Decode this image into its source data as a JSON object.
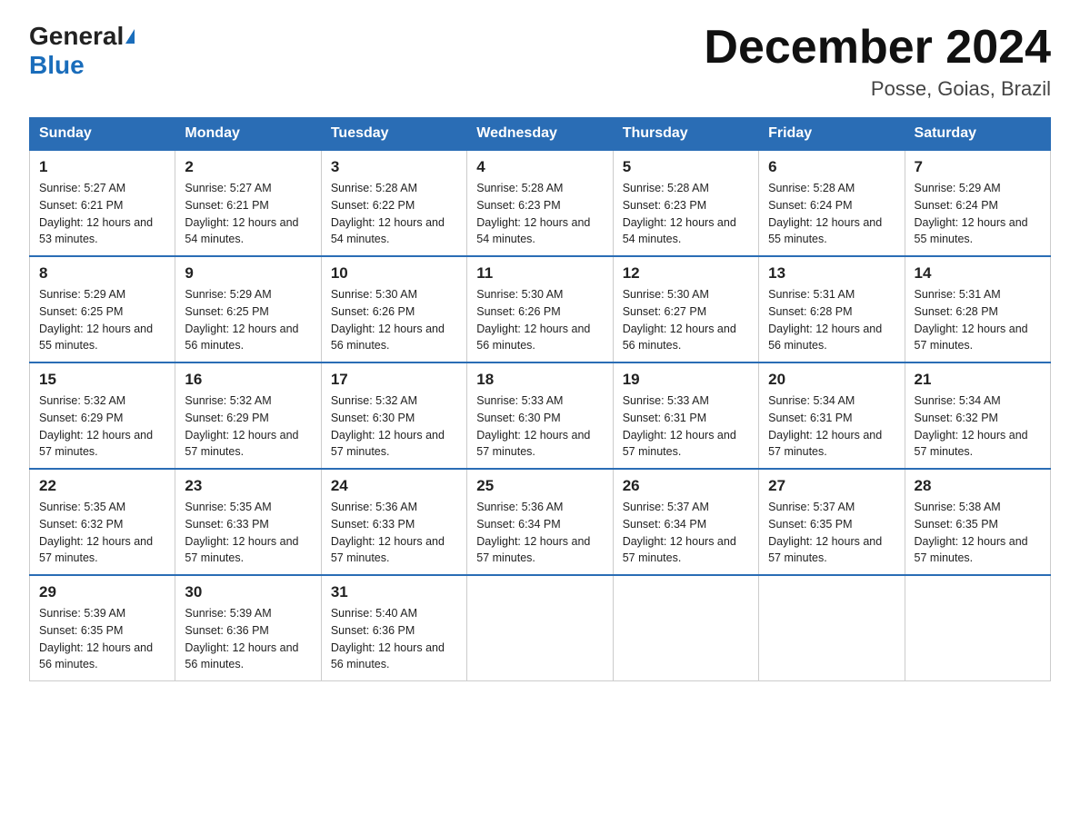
{
  "header": {
    "logo_general": "General",
    "logo_blue": "Blue",
    "month_title": "December 2024",
    "location": "Posse, Goias, Brazil"
  },
  "days_of_week": [
    "Sunday",
    "Monday",
    "Tuesday",
    "Wednesday",
    "Thursday",
    "Friday",
    "Saturday"
  ],
  "weeks": [
    [
      {
        "day": "1",
        "sunrise": "5:27 AM",
        "sunset": "6:21 PM",
        "daylight": "12 hours and 53 minutes."
      },
      {
        "day": "2",
        "sunrise": "5:27 AM",
        "sunset": "6:21 PM",
        "daylight": "12 hours and 54 minutes."
      },
      {
        "day": "3",
        "sunrise": "5:28 AM",
        "sunset": "6:22 PM",
        "daylight": "12 hours and 54 minutes."
      },
      {
        "day": "4",
        "sunrise": "5:28 AM",
        "sunset": "6:23 PM",
        "daylight": "12 hours and 54 minutes."
      },
      {
        "day": "5",
        "sunrise": "5:28 AM",
        "sunset": "6:23 PM",
        "daylight": "12 hours and 54 minutes."
      },
      {
        "day": "6",
        "sunrise": "5:28 AM",
        "sunset": "6:24 PM",
        "daylight": "12 hours and 55 minutes."
      },
      {
        "day": "7",
        "sunrise": "5:29 AM",
        "sunset": "6:24 PM",
        "daylight": "12 hours and 55 minutes."
      }
    ],
    [
      {
        "day": "8",
        "sunrise": "5:29 AM",
        "sunset": "6:25 PM",
        "daylight": "12 hours and 55 minutes."
      },
      {
        "day": "9",
        "sunrise": "5:29 AM",
        "sunset": "6:25 PM",
        "daylight": "12 hours and 56 minutes."
      },
      {
        "day": "10",
        "sunrise": "5:30 AM",
        "sunset": "6:26 PM",
        "daylight": "12 hours and 56 minutes."
      },
      {
        "day": "11",
        "sunrise": "5:30 AM",
        "sunset": "6:26 PM",
        "daylight": "12 hours and 56 minutes."
      },
      {
        "day": "12",
        "sunrise": "5:30 AM",
        "sunset": "6:27 PM",
        "daylight": "12 hours and 56 minutes."
      },
      {
        "day": "13",
        "sunrise": "5:31 AM",
        "sunset": "6:28 PM",
        "daylight": "12 hours and 56 minutes."
      },
      {
        "day": "14",
        "sunrise": "5:31 AM",
        "sunset": "6:28 PM",
        "daylight": "12 hours and 57 minutes."
      }
    ],
    [
      {
        "day": "15",
        "sunrise": "5:32 AM",
        "sunset": "6:29 PM",
        "daylight": "12 hours and 57 minutes."
      },
      {
        "day": "16",
        "sunrise": "5:32 AM",
        "sunset": "6:29 PM",
        "daylight": "12 hours and 57 minutes."
      },
      {
        "day": "17",
        "sunrise": "5:32 AM",
        "sunset": "6:30 PM",
        "daylight": "12 hours and 57 minutes."
      },
      {
        "day": "18",
        "sunrise": "5:33 AM",
        "sunset": "6:30 PM",
        "daylight": "12 hours and 57 minutes."
      },
      {
        "day": "19",
        "sunrise": "5:33 AM",
        "sunset": "6:31 PM",
        "daylight": "12 hours and 57 minutes."
      },
      {
        "day": "20",
        "sunrise": "5:34 AM",
        "sunset": "6:31 PM",
        "daylight": "12 hours and 57 minutes."
      },
      {
        "day": "21",
        "sunrise": "5:34 AM",
        "sunset": "6:32 PM",
        "daylight": "12 hours and 57 minutes."
      }
    ],
    [
      {
        "day": "22",
        "sunrise": "5:35 AM",
        "sunset": "6:32 PM",
        "daylight": "12 hours and 57 minutes."
      },
      {
        "day": "23",
        "sunrise": "5:35 AM",
        "sunset": "6:33 PM",
        "daylight": "12 hours and 57 minutes."
      },
      {
        "day": "24",
        "sunrise": "5:36 AM",
        "sunset": "6:33 PM",
        "daylight": "12 hours and 57 minutes."
      },
      {
        "day": "25",
        "sunrise": "5:36 AM",
        "sunset": "6:34 PM",
        "daylight": "12 hours and 57 minutes."
      },
      {
        "day": "26",
        "sunrise": "5:37 AM",
        "sunset": "6:34 PM",
        "daylight": "12 hours and 57 minutes."
      },
      {
        "day": "27",
        "sunrise": "5:37 AM",
        "sunset": "6:35 PM",
        "daylight": "12 hours and 57 minutes."
      },
      {
        "day": "28",
        "sunrise": "5:38 AM",
        "sunset": "6:35 PM",
        "daylight": "12 hours and 57 minutes."
      }
    ],
    [
      {
        "day": "29",
        "sunrise": "5:39 AM",
        "sunset": "6:35 PM",
        "daylight": "12 hours and 56 minutes."
      },
      {
        "day": "30",
        "sunrise": "5:39 AM",
        "sunset": "6:36 PM",
        "daylight": "12 hours and 56 minutes."
      },
      {
        "day": "31",
        "sunrise": "5:40 AM",
        "sunset": "6:36 PM",
        "daylight": "12 hours and 56 minutes."
      },
      null,
      null,
      null,
      null
    ]
  ]
}
